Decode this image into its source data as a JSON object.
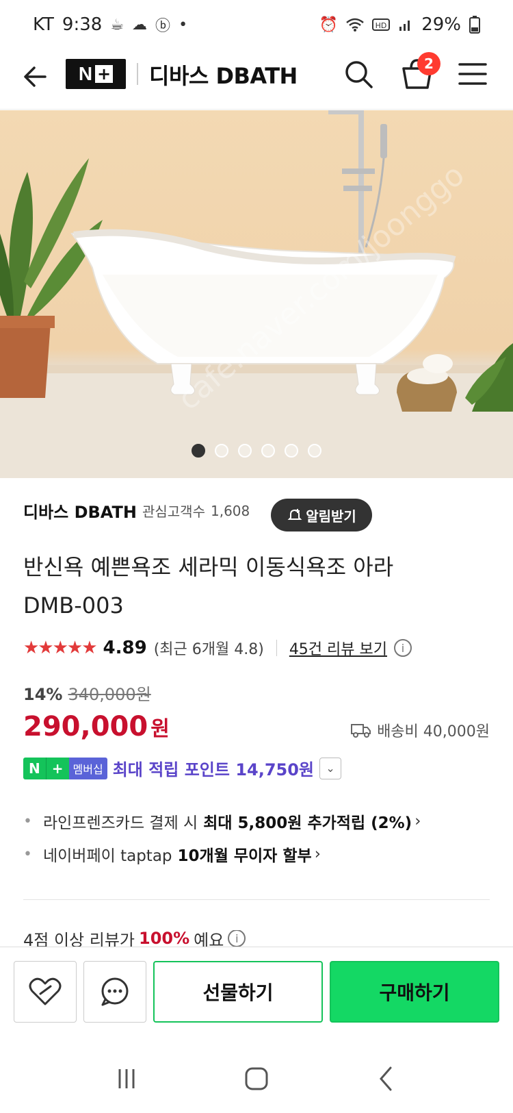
{
  "status_bar": {
    "carrier": "KT",
    "time": "9:38",
    "dot": "•",
    "battery": "29%"
  },
  "header": {
    "logo_n": "N",
    "logo_plus": "+",
    "title": "디바스 DBATH",
    "cart_count": "2"
  },
  "hero": {
    "slide_count": 6,
    "active_index": 0
  },
  "seller": {
    "name": "디바스 DBATH",
    "fans_label": "관심고객수",
    "fans_count": "1,608",
    "alarm_label": "알림받기"
  },
  "product": {
    "title_line1": "반신욕 예쁜욕조 세라믹 이동식욕조 아라",
    "title_line2": "DMB-003",
    "stars": "★★★★★",
    "rating": "4.89",
    "recent_rating": "(최근 6개월 4.8)",
    "reviews_link": "45건 리뷰 보기",
    "info": "i",
    "discount": "14%",
    "original_price": "340,000원",
    "price": "290,000",
    "price_unit": "원",
    "shipping": "배송비 40,000원"
  },
  "points": {
    "badge_n": "N",
    "badge_plus": "+",
    "badge_member": "멤버십",
    "text": "최대 적립 포인트 14,750원"
  },
  "benefits": [
    {
      "prefix": "라인프렌즈카드 결제 시",
      "bold": "최대 5,800원 추가적립 (2%)"
    },
    {
      "prefix": "네이버페이 taptap",
      "bold": "10개월 무이자 할부"
    }
  ],
  "review_hint": {
    "prefix": "4점 이상 리뷰가",
    "highlight": "100%",
    "suffix": "예요"
  },
  "bottom_bar": {
    "gift_label": "선물하기",
    "buy_label": "구매하기"
  },
  "colors": {
    "accent_red": "#c8102e",
    "naver_green": "#14c35a",
    "points_purple": "#5a44c9"
  }
}
